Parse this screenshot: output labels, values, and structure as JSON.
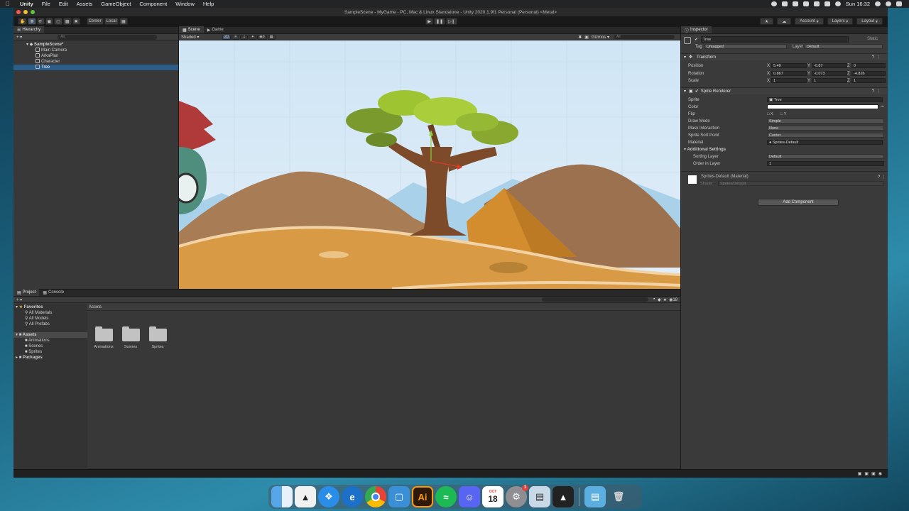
{
  "menubar": {
    "app": "Unity",
    "items": [
      "File",
      "Edit",
      "Assets",
      "GameObject",
      "Component",
      "Window",
      "Help"
    ],
    "clock": "Sun 16:32"
  },
  "window": {
    "title": "SampleScene - MyGame - PC, Mac & Linux Standalone - Unity 2020.1.9f1 Personal (Personal) <Metal>"
  },
  "toolbar": {
    "pivot_center": "Center",
    "pivot_local": "Local",
    "account": "Account",
    "layers": "Layers",
    "layout": "Layout"
  },
  "hierarchy": {
    "tab": "Hierarchy",
    "search_placeholder": "All",
    "scene": "SampleScene*",
    "items": [
      "Main Camera",
      "ArkaPlan",
      "Character",
      "Tree"
    ],
    "selected": "Tree"
  },
  "scene": {
    "tab_scene": "Scene",
    "tab_game": "Game",
    "shading": "Shaded",
    "mode_2d": "2D",
    "layers_count": "0",
    "gizmos": "Gizmos",
    "search_placeholder": "All"
  },
  "inspector": {
    "tab": "Inspector",
    "object_name": "Tree",
    "static_label": "Static",
    "tag_label": "Tag",
    "tag_value": "Untagged",
    "layer_label": "Layer",
    "layer_value": "Default",
    "transform": {
      "title": "Transform",
      "position_label": "Position",
      "rotation_label": "Rotation",
      "scale_label": "Scale",
      "position": {
        "x": "5.49",
        "y": "-0.87",
        "z": "0"
      },
      "rotation": {
        "x": "0.867",
        "y": "-0.073",
        "z": "-4.826"
      },
      "scale": {
        "x": "1",
        "y": "1",
        "z": "1"
      }
    },
    "sprite_renderer": {
      "title": "Sprite Renderer",
      "sprite_label": "Sprite",
      "sprite_value": "Tree",
      "color_label": "Color",
      "flip_label": "Flip",
      "flip_x": "X",
      "flip_y": "Y",
      "draw_mode_label": "Draw Mode",
      "draw_mode_value": "Simple",
      "mask_label": "Mask Interaction",
      "mask_value": "None",
      "sort_point_label": "Sprite Sort Point",
      "sort_point_value": "Center",
      "material_label": "Material",
      "material_value": "Sprites-Default",
      "additional": "Additional Settings",
      "sorting_layer_label": "Sorting Layer",
      "sorting_layer_value": "Default",
      "order_label": "Order in Layer",
      "order_value": "1"
    },
    "material": {
      "name": "Sprites-Default (Material)",
      "shader_label": "Shader",
      "shader_value": "Sprites/Default"
    },
    "add_component": "Add Component"
  },
  "project": {
    "tab_project": "Project",
    "tab_console": "Console",
    "favorites": "Favorites",
    "favorites_items": [
      "All Materials",
      "All Models",
      "All Prefabs"
    ],
    "assets": "Assets",
    "assets_items": [
      "Animations",
      "Scenes",
      "Sprites"
    ],
    "packages": "Packages",
    "breadcrumb": "Assets",
    "folders": [
      "Animations",
      "Scenes",
      "Sprites"
    ],
    "count": "18"
  },
  "dock": {
    "calendar_month": "OCT",
    "calendar_day": "18",
    "badge": "1",
    "illustrator": "Ai"
  },
  "colors": {
    "selection": "#2c5d87",
    "sky": "#d6e9f7",
    "sand": "#d89a45"
  }
}
